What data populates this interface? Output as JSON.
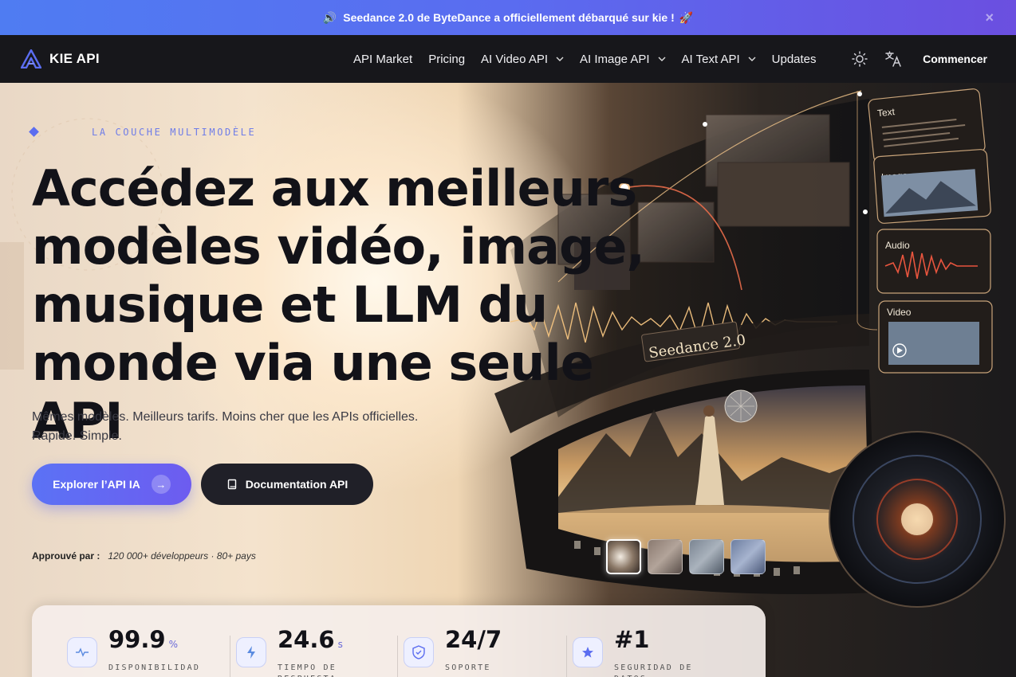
{
  "announcement": {
    "text": "Seedance 2.0 de ByteDance a officiellement débarqué sur kie !",
    "speaker_icon": "speaker-icon",
    "rocket": "🚀",
    "close": "×"
  },
  "nav": {
    "brand": "KIE API",
    "links": [
      {
        "label": "API Market",
        "dropdown": false
      },
      {
        "label": "Pricing",
        "dropdown": false
      },
      {
        "label": "AI Video API",
        "dropdown": true
      },
      {
        "label": "AI Image API",
        "dropdown": true
      },
      {
        "label": "AI Text API",
        "dropdown": true
      },
      {
        "label": "Updates",
        "dropdown": false
      }
    ],
    "theme_icon": "sun-icon",
    "language_icon": "translate-icon",
    "cta": "Commencer"
  },
  "hero": {
    "eyebrow": "LA COUCHE MULTIMODÈLE",
    "headline_lines": [
      "Accédez aux meilleurs",
      "modèles vidéo, image,",
      "musique et LLM du",
      "monde via une seule API"
    ],
    "subline_lines": [
      "Mêmes modèles. Meilleurs tarifs. Moins cher que les APIs officielles.",
      "Rapide. Simple."
    ],
    "primary_button": "Explorer l’API IA",
    "secondary_button": "Documentation API",
    "trust_label": "Approuvé par :",
    "trust_value": "120 000+ développeurs · 80+ pays",
    "art": {
      "panels": [
        "Text",
        "Image",
        "Audio",
        "Video"
      ],
      "badge": "Seedance 2.0"
    }
  },
  "stats": [
    {
      "value": "99.9",
      "unit": "%",
      "label": "DISPONIBILIDAD",
      "icon": "pulse-icon"
    },
    {
      "value": "24.6",
      "unit": "s",
      "label": "TIEMPO DE RESPUESTA",
      "icon": "bolt-icon"
    },
    {
      "value": "24/7",
      "unit": "",
      "label": "SOPORTE",
      "icon": "shield-icon"
    },
    {
      "value": "#1",
      "unit": "",
      "label": "SEGURIDAD DE DATOS",
      "icon": "star-icon"
    }
  ],
  "colors": {
    "accent": "#5b6df0",
    "announcement_gradient": [
      "#4f7cf2",
      "#6b4fe0"
    ],
    "nav_bg": "#17171b"
  }
}
